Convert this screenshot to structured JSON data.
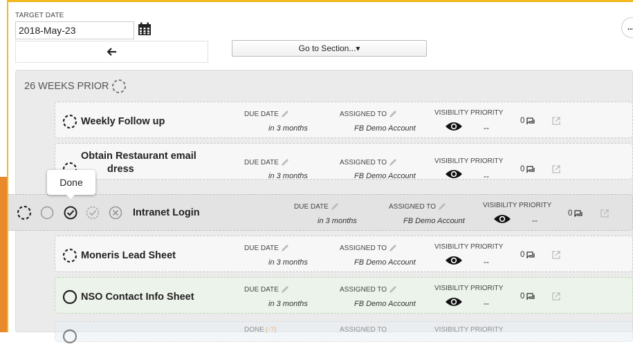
{
  "header": {
    "target_date_label": "TARGET DATE",
    "target_date_value": "2018-May-23",
    "back_label": "🡐",
    "goto_label": "Go to Section...▾",
    "more_label": "..."
  },
  "section": {
    "title": "26 WEEKS PRIOR"
  },
  "labels": {
    "due_date": "DUE DATE",
    "assigned_to": "ASSIGNED TO",
    "visibility_priority": "VISIBILITY PRIORITY"
  },
  "tasks": [
    {
      "title": "Weekly Follow up",
      "due": "in 3 months",
      "assigned": "FB Demo Account",
      "priority": "--",
      "comments": "0",
      "status": "pending"
    },
    {
      "title_line1": "Obtain Restaurant email",
      "title_line2": "dress",
      "due": "in 3 months",
      "assigned": "FB Demo Account",
      "priority": "--",
      "comments": "0",
      "status": "pending"
    },
    {
      "title": "Intranet Login",
      "due": "in 3 months",
      "assigned": "FB Demo Account",
      "priority": "--",
      "comments": "0",
      "status": "active"
    },
    {
      "title": "Moneris Lead Sheet",
      "due": "in 3 months",
      "assigned": "FB Demo Account",
      "priority": "--",
      "comments": "0",
      "status": "pending"
    },
    {
      "title": "NSO Contact Info Sheet",
      "due": "in 3 months",
      "assigned": "FB Demo Account",
      "priority": "--",
      "comments": "0",
      "status": "open"
    }
  ],
  "partial_row": {
    "due_label": "DONE",
    "due_extra": "(-?)",
    "assigned_label": "ASSIGNED TO",
    "vis_label": "VISIBILITY PRIORITY"
  },
  "tooltip": "Done",
  "colors": {
    "accent_orange": "#e8892b",
    "frame_yellow": "#f2b81e",
    "green_row": "#ecf3ea"
  }
}
